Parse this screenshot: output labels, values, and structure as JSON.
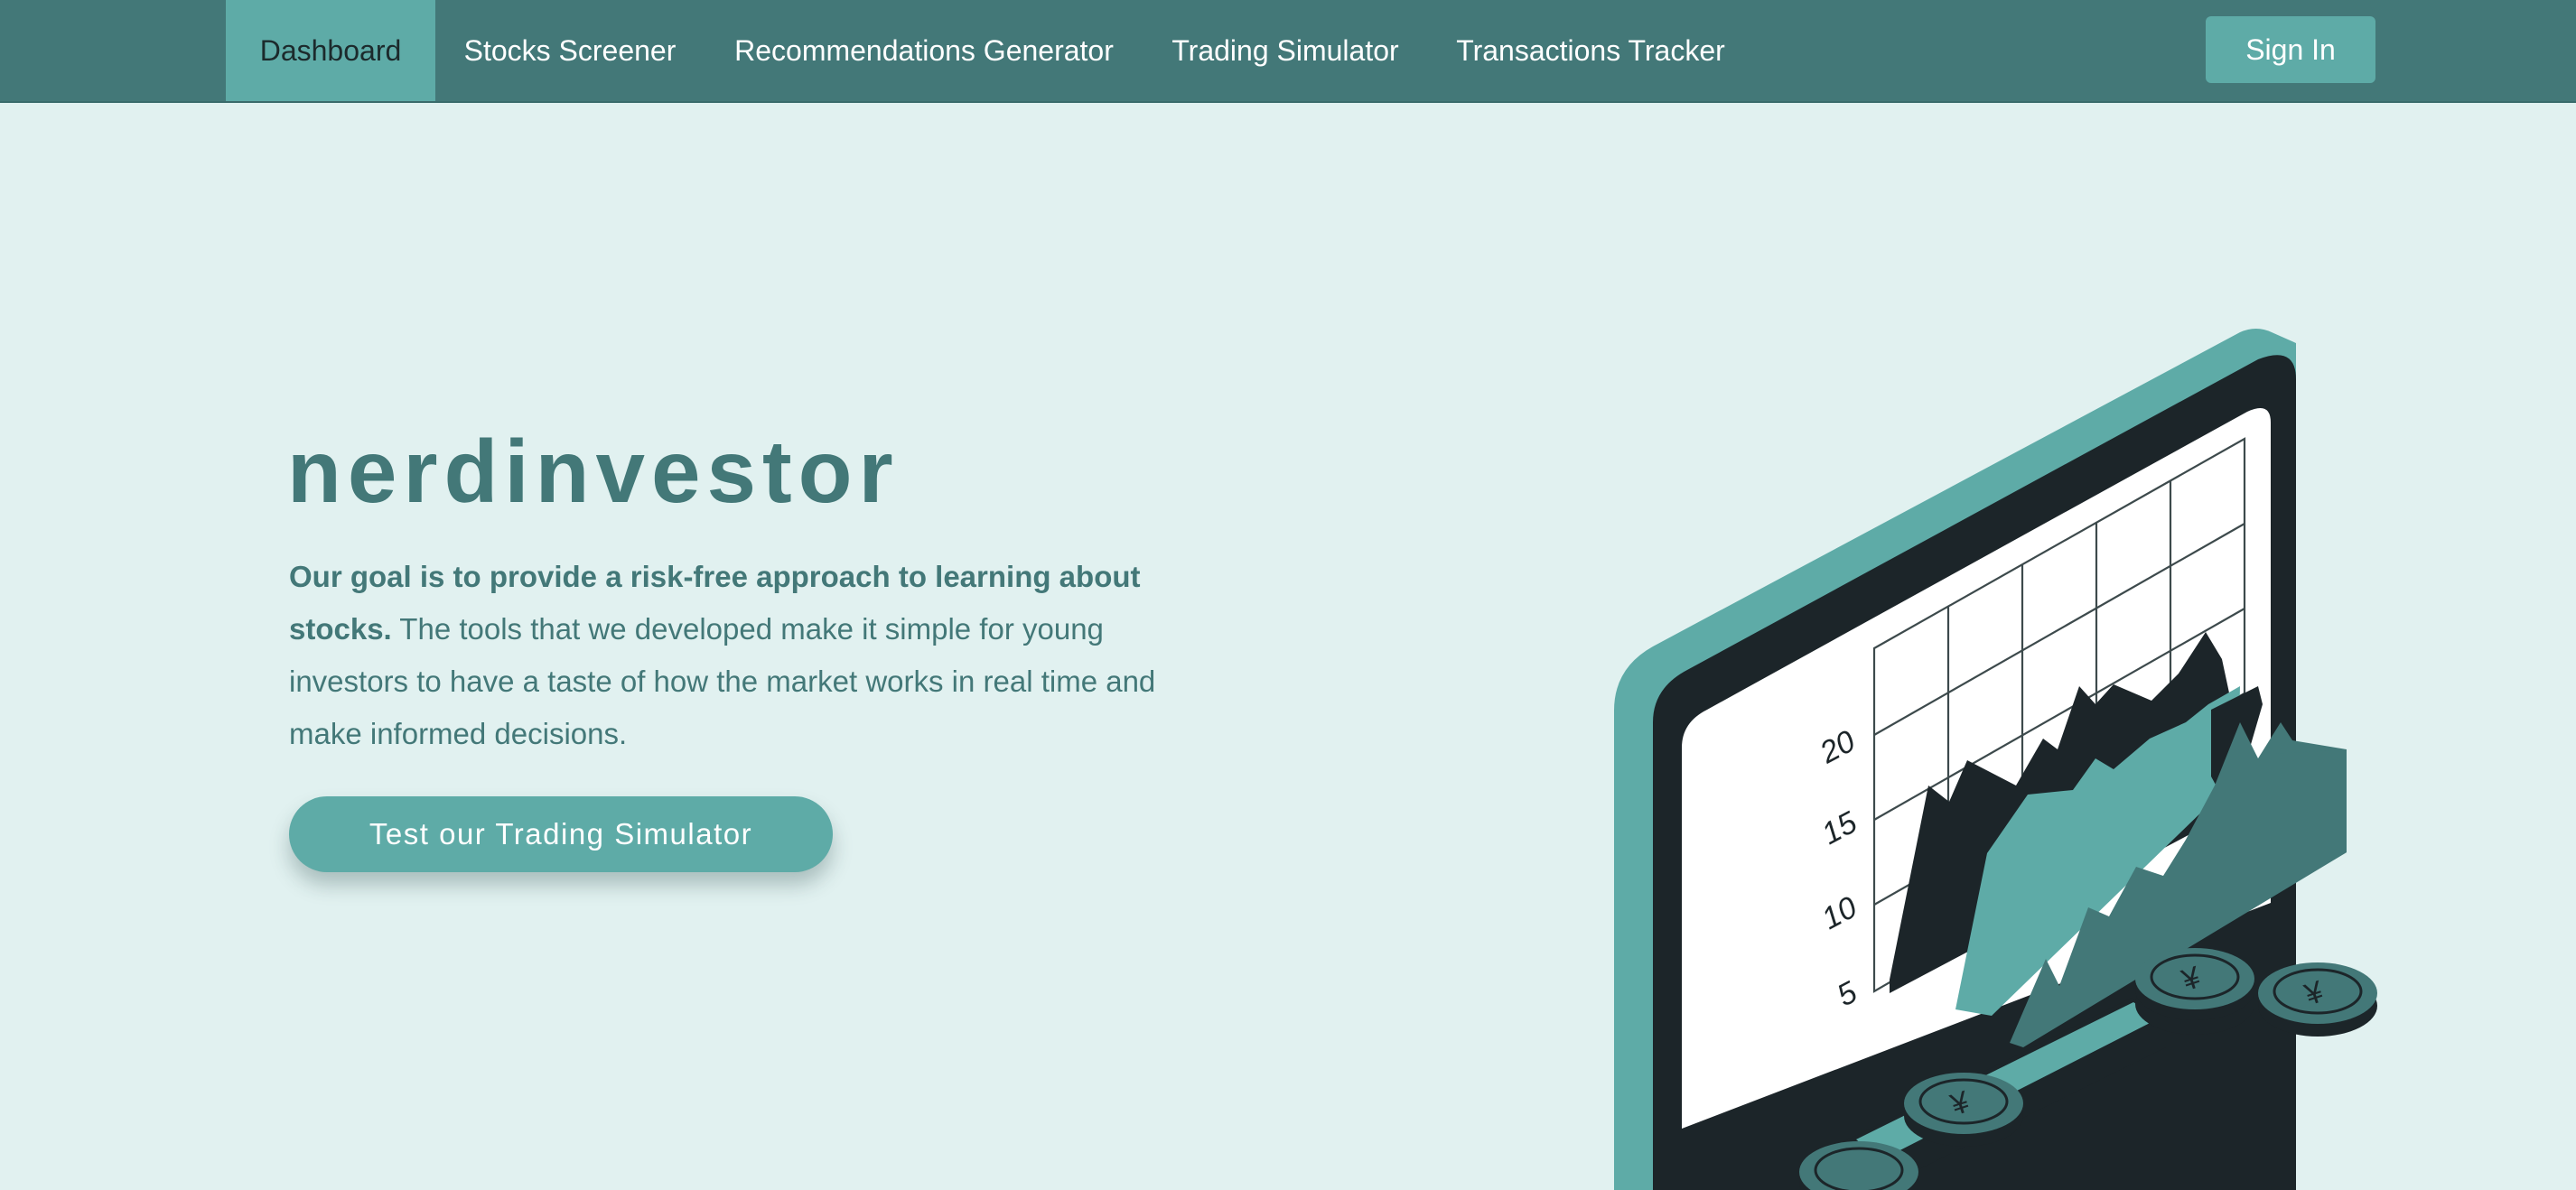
{
  "nav": {
    "items": [
      {
        "label": "Dashboard",
        "active": true
      },
      {
        "label": "Stocks Screener",
        "active": false
      },
      {
        "label": "Recommendations Generator",
        "active": false
      },
      {
        "label": "Trading Simulator",
        "active": false
      },
      {
        "label": "Transactions Tracker",
        "active": false
      }
    ],
    "signin_label": "Sign In"
  },
  "hero": {
    "title": "nerdinvestor",
    "intro_bold": "Our goal is to provide a risk-free approach to learning about stocks.",
    "intro_rest": " The tools that we developed make it simple for young investors to have a taste of how the market works in real time and make informed decisions.",
    "cta_label": "Test our Trading Simulator"
  },
  "illustration": {
    "y_ticks": [
      "20",
      "15",
      "10",
      "5"
    ],
    "coin_symbol": "¥"
  },
  "colors": {
    "nav_bg": "#437878",
    "accent": "#5eaba7",
    "page_bg": "#e1f1f0",
    "dark": "#1c2529"
  }
}
